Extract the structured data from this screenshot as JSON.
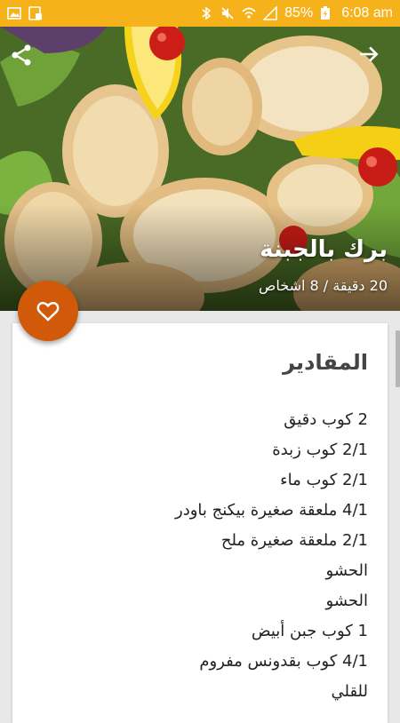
{
  "status_bar": {
    "battery": "85%",
    "time": "6:08 am",
    "left_icons": [
      "image-icon",
      "screenshot-icon"
    ],
    "right_icons": [
      "bluetooth-icon",
      "mute-icon",
      "wifi-icon",
      "signal-icon",
      "battery-charging-icon"
    ]
  },
  "recipe": {
    "title": "برك بالجبنة",
    "meta": "20 دقيقة / 8 اشخاص"
  },
  "ingredients_section": {
    "title": "المقادير",
    "items": [
      "2 كوب دقيق",
      "2/1 كوب زبدة",
      "2/1 كوب ماء",
      "4/1 ملعقة صغيرة بيكنج باودر",
      "2/1 ملعقة صغيرة ملح",
      "الحشو",
      "الحشو",
      "1 كوب جبن أبيض",
      "4/1 كوب بقدونس مفروم",
      "للقلي"
    ]
  },
  "colors": {
    "status_bar": "#f6b21b",
    "fab": "#d05a09"
  }
}
